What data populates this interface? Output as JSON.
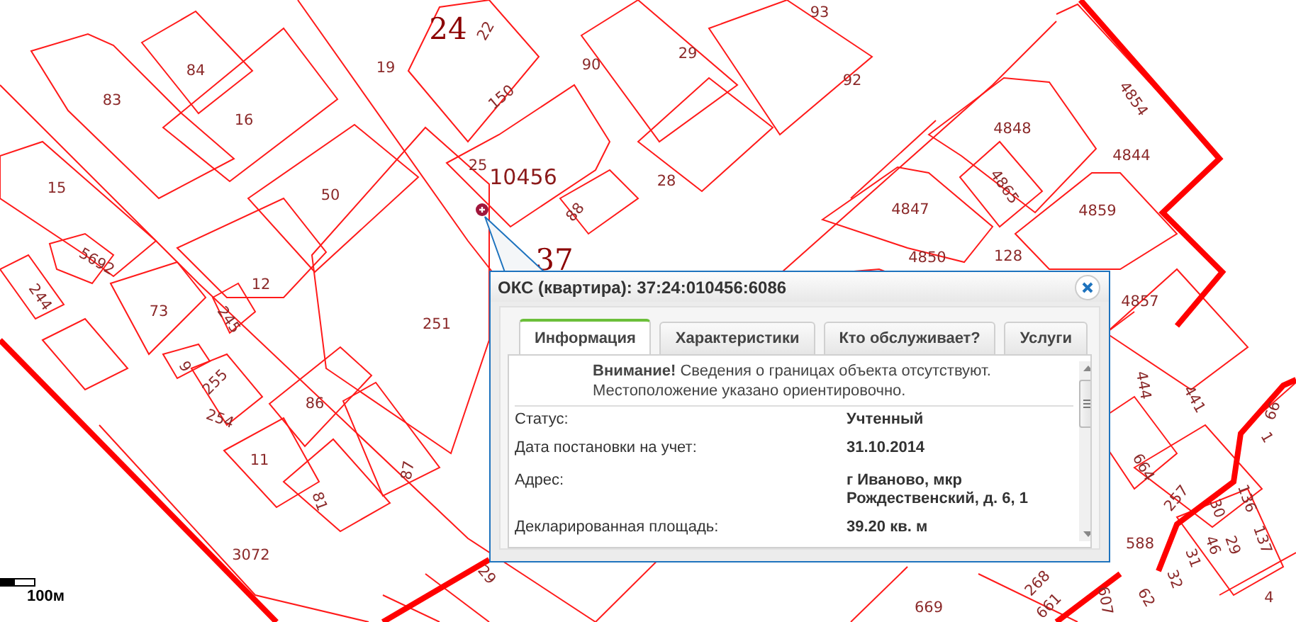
{
  "map": {
    "labels": [
      {
        "text": "24",
        "kind": "district"
      },
      {
        "text": "22",
        "kind": "parcel"
      },
      {
        "text": "93",
        "kind": "parcel"
      },
      {
        "text": "84",
        "kind": "parcel"
      },
      {
        "text": "19",
        "kind": "parcel"
      },
      {
        "text": "150",
        "kind": "parcel"
      },
      {
        "text": "90",
        "kind": "parcel"
      },
      {
        "text": "29",
        "kind": "parcel"
      },
      {
        "text": "92",
        "kind": "parcel"
      },
      {
        "text": "83",
        "kind": "parcel"
      },
      {
        "text": "16",
        "kind": "parcel"
      },
      {
        "text": "4854",
        "kind": "parcel"
      },
      {
        "text": "4848",
        "kind": "parcel"
      },
      {
        "text": "4844",
        "kind": "parcel"
      },
      {
        "text": "25",
        "kind": "parcel"
      },
      {
        "text": "10456",
        "kind": "quarter"
      },
      {
        "text": "28",
        "kind": "parcel"
      },
      {
        "text": "50",
        "kind": "parcel"
      },
      {
        "text": "15",
        "kind": "parcel"
      },
      {
        "text": "88",
        "kind": "parcel"
      },
      {
        "text": "4865",
        "kind": "parcel"
      },
      {
        "text": "4847",
        "kind": "parcel"
      },
      {
        "text": "4859",
        "kind": "parcel"
      },
      {
        "text": "37",
        "kind": "district"
      },
      {
        "text": "5692",
        "kind": "parcel"
      },
      {
        "text": "12",
        "kind": "parcel"
      },
      {
        "text": "4850",
        "kind": "parcel"
      },
      {
        "text": "128",
        "kind": "parcel"
      },
      {
        "text": "4857",
        "kind": "parcel"
      },
      {
        "text": "244",
        "kind": "parcel"
      },
      {
        "text": "73",
        "kind": "parcel"
      },
      {
        "text": "245",
        "kind": "parcel"
      },
      {
        "text": "251",
        "kind": "parcel"
      },
      {
        "text": "9",
        "kind": "parcel"
      },
      {
        "text": "255",
        "kind": "parcel"
      },
      {
        "text": "86",
        "kind": "parcel"
      },
      {
        "text": "254",
        "kind": "parcel"
      },
      {
        "text": "444",
        "kind": "parcel"
      },
      {
        "text": "441",
        "kind": "parcel"
      },
      {
        "text": "11",
        "kind": "parcel"
      },
      {
        "text": "87",
        "kind": "parcel"
      },
      {
        "text": "664",
        "kind": "parcel"
      },
      {
        "text": "81",
        "kind": "parcel"
      },
      {
        "text": "257",
        "kind": "parcel"
      },
      {
        "text": "66",
        "kind": "parcel"
      },
      {
        "text": "1",
        "kind": "parcel"
      },
      {
        "text": "136",
        "kind": "parcel"
      },
      {
        "text": "30",
        "kind": "parcel"
      },
      {
        "text": "137",
        "kind": "parcel"
      },
      {
        "text": "588",
        "kind": "parcel"
      },
      {
        "text": "29",
        "kind": "parcel"
      },
      {
        "text": "46",
        "kind": "parcel"
      },
      {
        "text": "31",
        "kind": "parcel"
      },
      {
        "text": "32",
        "kind": "parcel"
      },
      {
        "text": "3072",
        "kind": "parcel"
      },
      {
        "text": "62",
        "kind": "parcel"
      },
      {
        "text": "607",
        "kind": "parcel"
      },
      {
        "text": "669",
        "kind": "parcel"
      },
      {
        "text": "268",
        "kind": "parcel"
      },
      {
        "text": "661",
        "kind": "parcel"
      },
      {
        "text": "29",
        "kind": "parcel"
      },
      {
        "text": "4",
        "kind": "parcel"
      }
    ],
    "scale": {
      "label": "100м"
    }
  },
  "popup": {
    "title": "ОКС (квартира): 37:24:010456:6086",
    "tabs": [
      {
        "label": "Информация",
        "selected": true
      },
      {
        "label": "Характеристики",
        "selected": false
      },
      {
        "label": "Кто обслуживает?",
        "selected": false
      },
      {
        "label": "Услуги",
        "selected": false
      }
    ],
    "notice": "**Внимание!** Сведения о границах объекта отсутствуют. Местоположение указано ориентировочно.",
    "fields": [
      {
        "label": "Статус:",
        "value": "Учтенный"
      },
      {
        "label": "Дата постановки на учет:",
        "value": "31.10.2014"
      },
      {
        "label": "Адрес:",
        "value": "г Иваново, мкр Рождественский, д. 6, 1"
      },
      {
        "label": "Декларированная площадь:",
        "value": "39.20 кв. м"
      }
    ]
  }
}
